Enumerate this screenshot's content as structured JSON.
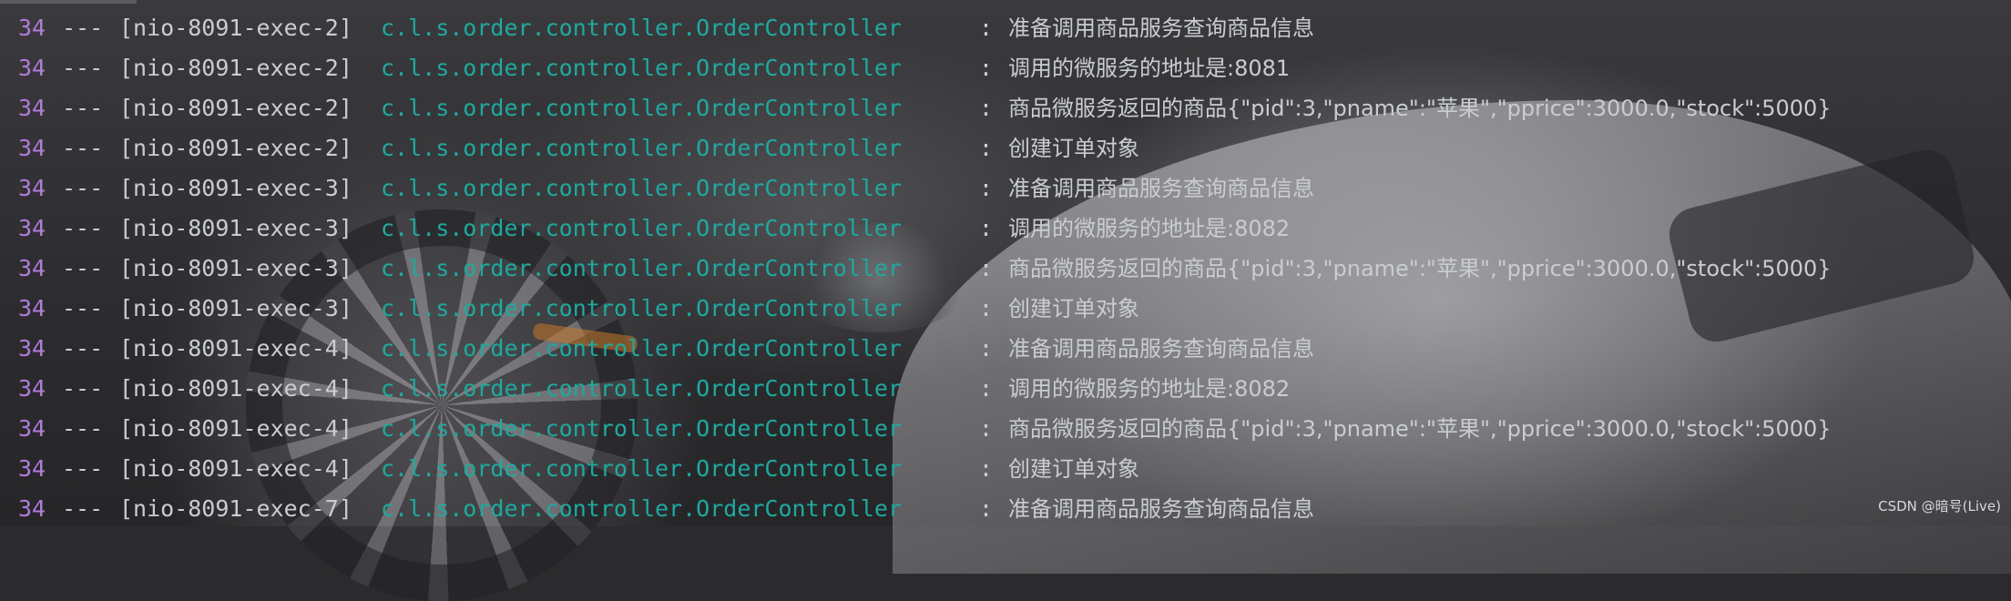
{
  "console": {
    "rows": [
      {
        "pid": "34",
        "sep": "---",
        "thread": "[nio-8091-exec-2]",
        "logger": "c.l.s.order.controller.OrderController",
        "colon": ":",
        "message": "准备调用商品服务查询商品信息"
      },
      {
        "pid": "34",
        "sep": "---",
        "thread": "[nio-8091-exec-2]",
        "logger": "c.l.s.order.controller.OrderController",
        "colon": ":",
        "message": "调用的微服务的地址是:8081"
      },
      {
        "pid": "34",
        "sep": "---",
        "thread": "[nio-8091-exec-2]",
        "logger": "c.l.s.order.controller.OrderController",
        "colon": ":",
        "message": "商品微服务返回的商品{\"pid\":3,\"pname\":\"苹果\",\"pprice\":3000.0,\"stock\":5000}"
      },
      {
        "pid": "34",
        "sep": "---",
        "thread": "[nio-8091-exec-2]",
        "logger": "c.l.s.order.controller.OrderController",
        "colon": ":",
        "message": "创建订单对象"
      },
      {
        "pid": "34",
        "sep": "---",
        "thread": "[nio-8091-exec-3]",
        "logger": "c.l.s.order.controller.OrderController",
        "colon": ":",
        "message": "准备调用商品服务查询商品信息"
      },
      {
        "pid": "34",
        "sep": "---",
        "thread": "[nio-8091-exec-3]",
        "logger": "c.l.s.order.controller.OrderController",
        "colon": ":",
        "message": "调用的微服务的地址是:8082"
      },
      {
        "pid": "34",
        "sep": "---",
        "thread": "[nio-8091-exec-3]",
        "logger": "c.l.s.order.controller.OrderController",
        "colon": ":",
        "message": "商品微服务返回的商品{\"pid\":3,\"pname\":\"苹果\",\"pprice\":3000.0,\"stock\":5000}"
      },
      {
        "pid": "34",
        "sep": "---",
        "thread": "[nio-8091-exec-3]",
        "logger": "c.l.s.order.controller.OrderController",
        "colon": ":",
        "message": "创建订单对象"
      },
      {
        "pid": "34",
        "sep": "---",
        "thread": "[nio-8091-exec-4]",
        "logger": "c.l.s.order.controller.OrderController",
        "colon": ":",
        "message": "准备调用商品服务查询商品信息"
      },
      {
        "pid": "34",
        "sep": "---",
        "thread": "[nio-8091-exec-4]",
        "logger": "c.l.s.order.controller.OrderController",
        "colon": ":",
        "message": "调用的微服务的地址是:8082"
      },
      {
        "pid": "34",
        "sep": "---",
        "thread": "[nio-8091-exec-4]",
        "logger": "c.l.s.order.controller.OrderController",
        "colon": ":",
        "message": "商品微服务返回的商品{\"pid\":3,\"pname\":\"苹果\",\"pprice\":3000.0,\"stock\":5000}"
      },
      {
        "pid": "34",
        "sep": "---",
        "thread": "[nio-8091-exec-4]",
        "logger": "c.l.s.order.controller.OrderController",
        "colon": ":",
        "message": "创建订单对象"
      },
      {
        "pid": "34",
        "sep": "---",
        "thread": "[nio-8091-exec-7]",
        "logger": "c.l.s.order.controller.OrderController",
        "colon": ":",
        "message": "准备调用商品服务查询商品信息"
      }
    ]
  },
  "watermark": "CSDN @暗号(Live)",
  "colors": {
    "pid": "#b07cd8",
    "logger": "#1fa99f",
    "text": "#c9cdd2",
    "background": "#2b2b2d"
  }
}
